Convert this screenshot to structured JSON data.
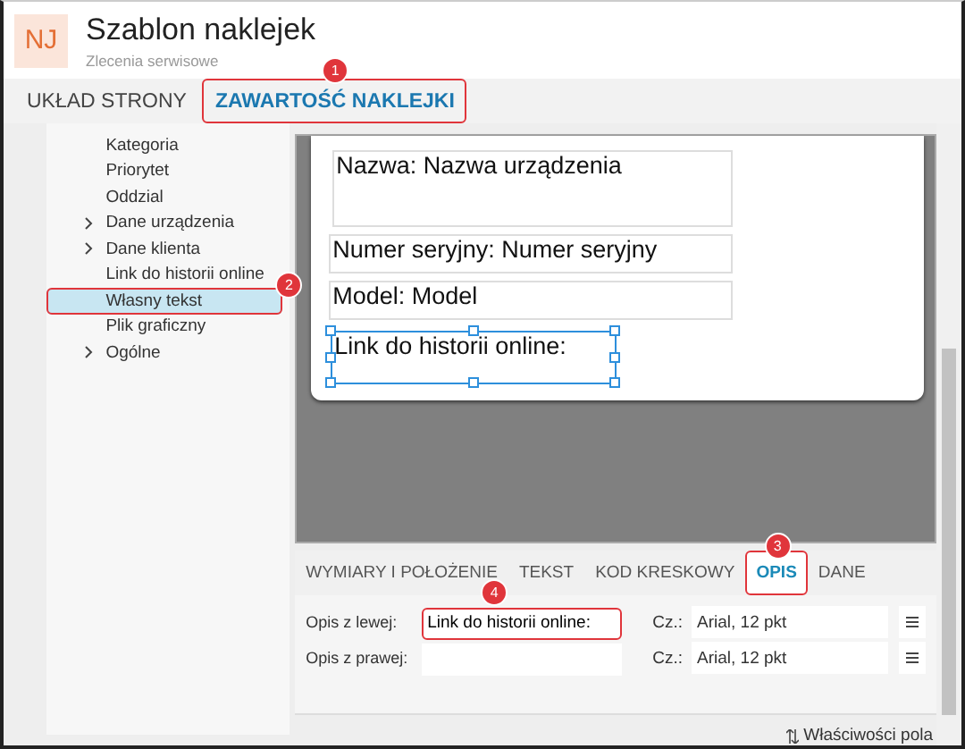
{
  "window": {
    "initials": "NJ",
    "title": "Szablon naklejek",
    "subtitle": "Zlecenia serwisowe"
  },
  "tabs": [
    {
      "label": "UKŁAD STRONY",
      "selected": false
    },
    {
      "label": "ZAWARTOŚĆ NAKLEJKI",
      "selected": true,
      "callout": "1"
    }
  ],
  "tree": [
    {
      "label": "Kategoria",
      "kind": "leaf",
      "selected": false
    },
    {
      "label": "Priorytet",
      "kind": "leaf",
      "selected": false
    },
    {
      "label": "Oddzial",
      "kind": "leaf",
      "selected": false
    },
    {
      "label": "Dane urządzenia",
      "kind": "group",
      "selected": false
    },
    {
      "label": "Dane klienta",
      "kind": "group",
      "selected": false
    },
    {
      "label": "Link do historii online",
      "kind": "leaf",
      "selected": false
    },
    {
      "label": "Własny tekst",
      "kind": "leaf",
      "selected": true,
      "callout": "2"
    },
    {
      "label": "Plik graficzny",
      "kind": "leaf",
      "selected": false
    },
    {
      "label": "Ogólne",
      "kind": "group",
      "selected": false
    }
  ],
  "label_fields": [
    {
      "text": "Nazwa: Nazwa urządzenia",
      "kind": "tall",
      "selected": false
    },
    {
      "text": "Numer seryjny: Numer seryjny",
      "kind": "line",
      "selected": false
    },
    {
      "text": "Model: Model",
      "kind": "line",
      "selected": false
    },
    {
      "text": "Link do historii online:",
      "kind": "short",
      "selected": true
    }
  ],
  "property_tabs": [
    {
      "label": "WYMIARY I POŁOŻENIE",
      "selected": false
    },
    {
      "label": "TEKST",
      "selected": false
    },
    {
      "label": "KOD KRESKOWY",
      "selected": false
    },
    {
      "label": "OPIS",
      "selected": true,
      "callout": "3"
    },
    {
      "label": "DANE",
      "selected": false
    }
  ],
  "description_rows": [
    {
      "label": "Opis z lewej:",
      "value": "Link do historii online:",
      "font_label": "Cz.:",
      "font": "Arial, 12 pkt",
      "callout": "4"
    },
    {
      "label": "Opis z prawej:",
      "font_label": "Cz.:",
      "font": "Arial, 12 pkt"
    }
  ],
  "footer_button": "Właściwości pola"
}
